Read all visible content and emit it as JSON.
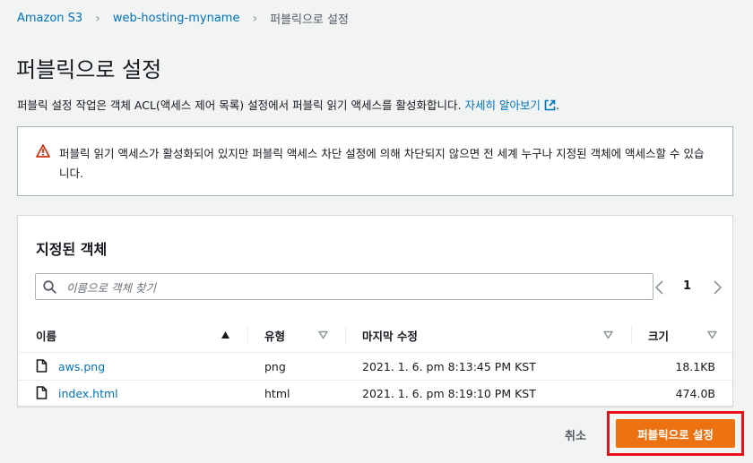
{
  "breadcrumb": {
    "items": [
      "Amazon S3",
      "web-hosting-myname",
      "퍼블릭으로 설정"
    ]
  },
  "page": {
    "title": "퍼블릭으로 설정",
    "description": "퍼블릭 설정 작업은 객체 ACL(액세스 제어 목록) 설정에서 퍼블릭 읽기 액세스를 활성화합니다.",
    "learn_more": "자세히 알아보기",
    "description_end": "."
  },
  "alert": {
    "text": "퍼블릭 읽기 액세스가 활성화되어 있지만 퍼블릭 액세스 차단 설정에 의해 차단되지 않으면 전 세계 누구나 지정된 객체에 액세스할 수 있습니다.",
    "icon": "warning-icon",
    "color": "#d13212"
  },
  "objects_panel": {
    "title": "지정된 객체",
    "search_placeholder": "이름으로 객체 찾기",
    "page_number": "1",
    "columns": [
      "이름",
      "유형",
      "마지막 수정",
      "크기"
    ],
    "rows": [
      {
        "name": "aws.png",
        "type": "png",
        "modified": "2021. 1. 6. pm 8:13:45 PM KST",
        "size": "18.1KB"
      },
      {
        "name": "index.html",
        "type": "html",
        "modified": "2021. 1. 6. pm 8:19:10 PM KST",
        "size": "474.0B"
      }
    ]
  },
  "actions": {
    "cancel": "취소",
    "submit": "퍼블릭으로 설정"
  },
  "colors": {
    "link": "#0073bb",
    "primary": "#ec7211",
    "highlight": "#e8131a"
  }
}
